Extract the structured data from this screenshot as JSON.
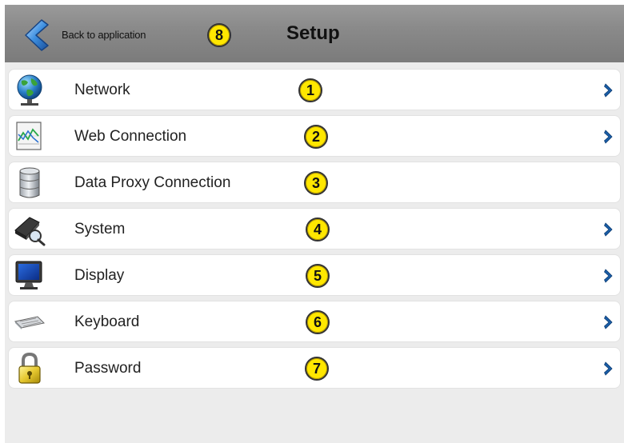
{
  "header": {
    "back_label": "Back to application",
    "title": "Setup",
    "badge": "8"
  },
  "menu": {
    "items": [
      {
        "label": "Network",
        "icon": "globe-network-icon",
        "badge": "1",
        "has_chevron": true
      },
      {
        "label": "Web Connection",
        "icon": "chart-web-icon",
        "badge": "2",
        "has_chevron": true
      },
      {
        "label": "Data Proxy Connection",
        "icon": "database-icon",
        "badge": "3",
        "has_chevron": false
      },
      {
        "label": "System",
        "icon": "system-device-icon",
        "badge": "4",
        "has_chevron": true
      },
      {
        "label": "Display",
        "icon": "monitor-icon",
        "badge": "5",
        "has_chevron": true
      },
      {
        "label": "Keyboard",
        "icon": "keyboard-icon",
        "badge": "6",
        "has_chevron": true
      },
      {
        "label": "Password",
        "icon": "padlock-icon",
        "badge": "7",
        "has_chevron": true
      }
    ]
  },
  "colors": {
    "header_bg": "#8a8a8a",
    "badge_bg": "#ffe700",
    "chevron_blue": "#1a5ea8",
    "row_bg": "#ffffff",
    "page_bg": "#ececec"
  }
}
